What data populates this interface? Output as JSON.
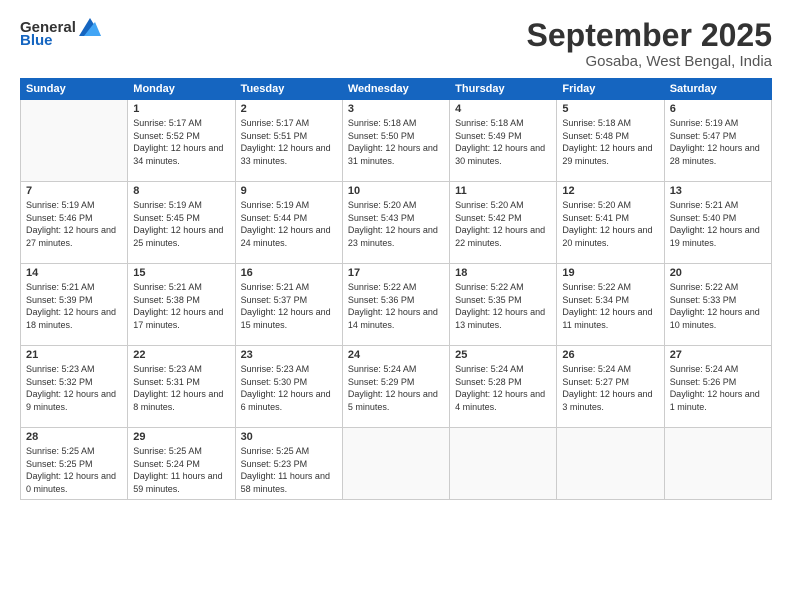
{
  "logo": {
    "general": "General",
    "blue": "Blue"
  },
  "header": {
    "month": "September 2025",
    "location": "Gosaba, West Bengal, India"
  },
  "weekdays": [
    "Sunday",
    "Monday",
    "Tuesday",
    "Wednesday",
    "Thursday",
    "Friday",
    "Saturday"
  ],
  "weeks": [
    [
      {
        "day": "",
        "sunrise": "",
        "sunset": "",
        "daylight": ""
      },
      {
        "day": "1",
        "sunrise": "Sunrise: 5:17 AM",
        "sunset": "Sunset: 5:52 PM",
        "daylight": "Daylight: 12 hours and 34 minutes."
      },
      {
        "day": "2",
        "sunrise": "Sunrise: 5:17 AM",
        "sunset": "Sunset: 5:51 PM",
        "daylight": "Daylight: 12 hours and 33 minutes."
      },
      {
        "day": "3",
        "sunrise": "Sunrise: 5:18 AM",
        "sunset": "Sunset: 5:50 PM",
        "daylight": "Daylight: 12 hours and 31 minutes."
      },
      {
        "day": "4",
        "sunrise": "Sunrise: 5:18 AM",
        "sunset": "Sunset: 5:49 PM",
        "daylight": "Daylight: 12 hours and 30 minutes."
      },
      {
        "day": "5",
        "sunrise": "Sunrise: 5:18 AM",
        "sunset": "Sunset: 5:48 PM",
        "daylight": "Daylight: 12 hours and 29 minutes."
      },
      {
        "day": "6",
        "sunrise": "Sunrise: 5:19 AM",
        "sunset": "Sunset: 5:47 PM",
        "daylight": "Daylight: 12 hours and 28 minutes."
      }
    ],
    [
      {
        "day": "7",
        "sunrise": "Sunrise: 5:19 AM",
        "sunset": "Sunset: 5:46 PM",
        "daylight": "Daylight: 12 hours and 27 minutes."
      },
      {
        "day": "8",
        "sunrise": "Sunrise: 5:19 AM",
        "sunset": "Sunset: 5:45 PM",
        "daylight": "Daylight: 12 hours and 25 minutes."
      },
      {
        "day": "9",
        "sunrise": "Sunrise: 5:19 AM",
        "sunset": "Sunset: 5:44 PM",
        "daylight": "Daylight: 12 hours and 24 minutes."
      },
      {
        "day": "10",
        "sunrise": "Sunrise: 5:20 AM",
        "sunset": "Sunset: 5:43 PM",
        "daylight": "Daylight: 12 hours and 23 minutes."
      },
      {
        "day": "11",
        "sunrise": "Sunrise: 5:20 AM",
        "sunset": "Sunset: 5:42 PM",
        "daylight": "Daylight: 12 hours and 22 minutes."
      },
      {
        "day": "12",
        "sunrise": "Sunrise: 5:20 AM",
        "sunset": "Sunset: 5:41 PM",
        "daylight": "Daylight: 12 hours and 20 minutes."
      },
      {
        "day": "13",
        "sunrise": "Sunrise: 5:21 AM",
        "sunset": "Sunset: 5:40 PM",
        "daylight": "Daylight: 12 hours and 19 minutes."
      }
    ],
    [
      {
        "day": "14",
        "sunrise": "Sunrise: 5:21 AM",
        "sunset": "Sunset: 5:39 PM",
        "daylight": "Daylight: 12 hours and 18 minutes."
      },
      {
        "day": "15",
        "sunrise": "Sunrise: 5:21 AM",
        "sunset": "Sunset: 5:38 PM",
        "daylight": "Daylight: 12 hours and 17 minutes."
      },
      {
        "day": "16",
        "sunrise": "Sunrise: 5:21 AM",
        "sunset": "Sunset: 5:37 PM",
        "daylight": "Daylight: 12 hours and 15 minutes."
      },
      {
        "day": "17",
        "sunrise": "Sunrise: 5:22 AM",
        "sunset": "Sunset: 5:36 PM",
        "daylight": "Daylight: 12 hours and 14 minutes."
      },
      {
        "day": "18",
        "sunrise": "Sunrise: 5:22 AM",
        "sunset": "Sunset: 5:35 PM",
        "daylight": "Daylight: 12 hours and 13 minutes."
      },
      {
        "day": "19",
        "sunrise": "Sunrise: 5:22 AM",
        "sunset": "Sunset: 5:34 PM",
        "daylight": "Daylight: 12 hours and 11 minutes."
      },
      {
        "day": "20",
        "sunrise": "Sunrise: 5:22 AM",
        "sunset": "Sunset: 5:33 PM",
        "daylight": "Daylight: 12 hours and 10 minutes."
      }
    ],
    [
      {
        "day": "21",
        "sunrise": "Sunrise: 5:23 AM",
        "sunset": "Sunset: 5:32 PM",
        "daylight": "Daylight: 12 hours and 9 minutes."
      },
      {
        "day": "22",
        "sunrise": "Sunrise: 5:23 AM",
        "sunset": "Sunset: 5:31 PM",
        "daylight": "Daylight: 12 hours and 8 minutes."
      },
      {
        "day": "23",
        "sunrise": "Sunrise: 5:23 AM",
        "sunset": "Sunset: 5:30 PM",
        "daylight": "Daylight: 12 hours and 6 minutes."
      },
      {
        "day": "24",
        "sunrise": "Sunrise: 5:24 AM",
        "sunset": "Sunset: 5:29 PM",
        "daylight": "Daylight: 12 hours and 5 minutes."
      },
      {
        "day": "25",
        "sunrise": "Sunrise: 5:24 AM",
        "sunset": "Sunset: 5:28 PM",
        "daylight": "Daylight: 12 hours and 4 minutes."
      },
      {
        "day": "26",
        "sunrise": "Sunrise: 5:24 AM",
        "sunset": "Sunset: 5:27 PM",
        "daylight": "Daylight: 12 hours and 3 minutes."
      },
      {
        "day": "27",
        "sunrise": "Sunrise: 5:24 AM",
        "sunset": "Sunset: 5:26 PM",
        "daylight": "Daylight: 12 hours and 1 minute."
      }
    ],
    [
      {
        "day": "28",
        "sunrise": "Sunrise: 5:25 AM",
        "sunset": "Sunset: 5:25 PM",
        "daylight": "Daylight: 12 hours and 0 minutes."
      },
      {
        "day": "29",
        "sunrise": "Sunrise: 5:25 AM",
        "sunset": "Sunset: 5:24 PM",
        "daylight": "Daylight: 11 hours and 59 minutes."
      },
      {
        "day": "30",
        "sunrise": "Sunrise: 5:25 AM",
        "sunset": "Sunset: 5:23 PM",
        "daylight": "Daylight: 11 hours and 58 minutes."
      },
      {
        "day": "",
        "sunrise": "",
        "sunset": "",
        "daylight": ""
      },
      {
        "day": "",
        "sunrise": "",
        "sunset": "",
        "daylight": ""
      },
      {
        "day": "",
        "sunrise": "",
        "sunset": "",
        "daylight": ""
      },
      {
        "day": "",
        "sunrise": "",
        "sunset": "",
        "daylight": ""
      }
    ]
  ]
}
